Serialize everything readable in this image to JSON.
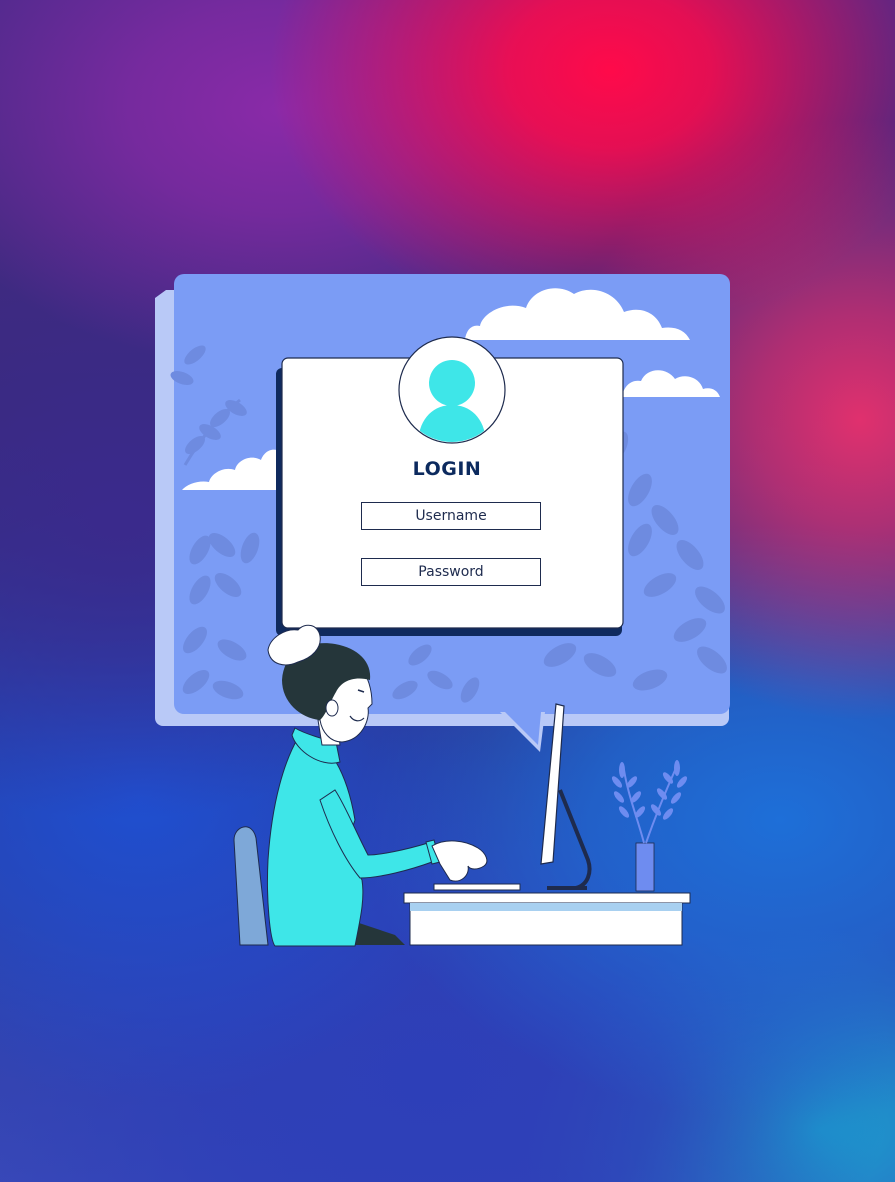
{
  "login": {
    "title": "LOGIN",
    "username_label": "Username",
    "password_label": "Password"
  },
  "colors": {
    "panel": "#7b9cf5",
    "panel_shadow": "#b9c9f7",
    "card": "#ffffff",
    "title": "#0c2a5e",
    "avatar": "#3ee6e8",
    "leaf": "#6e8be0",
    "sweater": "#3ee6e8"
  },
  "icons": [
    "user-avatar-icon",
    "cloud-icon",
    "leaf-icon",
    "plant-icon",
    "monitor-icon"
  ]
}
